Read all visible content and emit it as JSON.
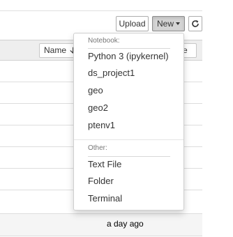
{
  "toolbar": {
    "upload_label": "Upload",
    "new_label": "New",
    "refresh_icon": "refresh-icon"
  },
  "file_list": {
    "sort_name_label": "Name",
    "sort_name_arrow": "🡣",
    "sort_size_label": "ze",
    "visible_last_modified": "a day ago"
  },
  "new_menu": {
    "notebook_header": "Notebook:",
    "notebook_items": [
      "Python 3 (ipykernel)",
      "ds_project1",
      "geo",
      "geo2",
      "ptenv1"
    ],
    "other_header": "Other:",
    "other_items": [
      "Text File",
      "Folder",
      "Terminal"
    ]
  },
  "colors": {
    "active_button_bg": "#d4d4d4",
    "header_bg": "#eeeeee"
  }
}
